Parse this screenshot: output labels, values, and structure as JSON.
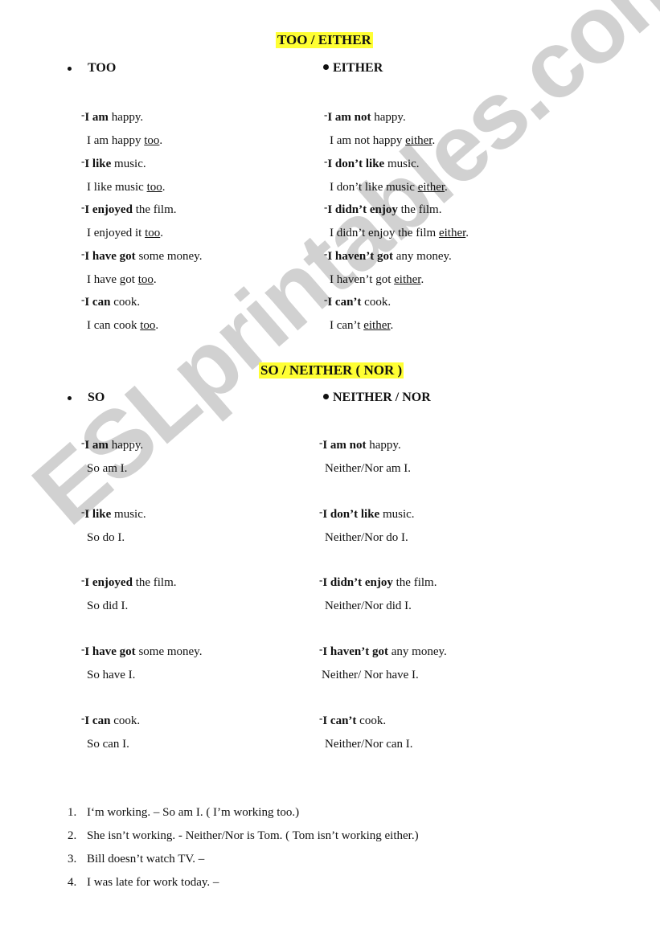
{
  "watermark": "ESLprintables.com",
  "section1": {
    "title": "TOO / EITHER",
    "left_heading": "TOO",
    "right_heading": "EITHER",
    "left": [
      {
        "bold": "I am",
        "rest": " happy.",
        "reply_pre": "I am happy ",
        "reply_key": "too",
        "reply_post": "."
      },
      {
        "bold": "I like",
        "rest": " music.",
        "reply_pre": "I like music ",
        "reply_key": "too",
        "reply_post": "."
      },
      {
        "bold": "I enjoyed",
        "rest": " the film.",
        "reply_pre": "I enjoyed it ",
        "reply_key": "too",
        "reply_post": "."
      },
      {
        "bold": "I have got",
        "rest": " some money.",
        "reply_pre": "I have got ",
        "reply_key": "too",
        "reply_post": "."
      },
      {
        "bold": "I can",
        "rest": " cook.",
        "reply_pre": "I can cook ",
        "reply_key": "too",
        "reply_post": "."
      }
    ],
    "right": [
      {
        "bold": "I am not",
        "rest": " happy.",
        "reply_pre": "I am not happy ",
        "reply_key": "either",
        "reply_post": "."
      },
      {
        "bold": "I don’t like",
        "rest": " music.",
        "reply_pre": "I don’t like music ",
        "reply_key": "either",
        "reply_post": "."
      },
      {
        "bold": "I didn’t enjoy",
        "rest": " the film.",
        "reply_pre": "I didn’t enjoy the film ",
        "reply_key": "either",
        "reply_post": "."
      },
      {
        "bold": "I haven’t got",
        "rest": " any money.",
        "reply_pre": "I haven’t got ",
        "reply_key": "either",
        "reply_post": "."
      },
      {
        "bold": "I can’t",
        "rest": " cook.",
        "reply_pre": "I can’t ",
        "reply_key": "either",
        "reply_post": "."
      }
    ]
  },
  "section2": {
    "title": "SO / NEITHER ( NOR )",
    "left_heading": "SO",
    "right_heading": "NEITHER / NOR",
    "left": [
      {
        "bold": "I am",
        "rest": " happy.",
        "reply": "So am I."
      },
      {
        "bold": "I like",
        "rest": " music.",
        "reply": "So do I."
      },
      {
        "bold": "I enjoyed",
        "rest": " the film.",
        "reply": "So did I."
      },
      {
        "bold": "I have got",
        "rest": " some money.",
        "reply": "So have I."
      },
      {
        "bold": "I can",
        "rest": " cook.",
        "reply": "So can I."
      }
    ],
    "right": [
      {
        "bold": "I am not",
        "rest": " happy.",
        "reply": "Neither/Nor am I."
      },
      {
        "bold": "I don’t like",
        "rest": " music.",
        "reply": "Neither/Nor do I."
      },
      {
        "bold": "I didn’t enjoy",
        "rest": " the film.",
        "reply": "Neither/Nor did I."
      },
      {
        "bold": "I haven’t got",
        "rest": " any money.",
        "reply": "Neither/ Nor have I."
      },
      {
        "bold": "I can’t",
        "rest": " cook.",
        "reply": "Neither/Nor can I."
      }
    ]
  },
  "exercises": [
    {
      "num": "1.",
      "text": "I‘m working. – So am I. ( I’m working too.)"
    },
    {
      "num": "2.",
      "text": "She isn’t working. -  Neither/Nor is Tom. ( Tom isn’t working either.)"
    },
    {
      "num": "3.",
      "text": "Bill doesn’t watch TV. –"
    },
    {
      "num": "4.",
      "text": "I was late for work today. –"
    }
  ]
}
